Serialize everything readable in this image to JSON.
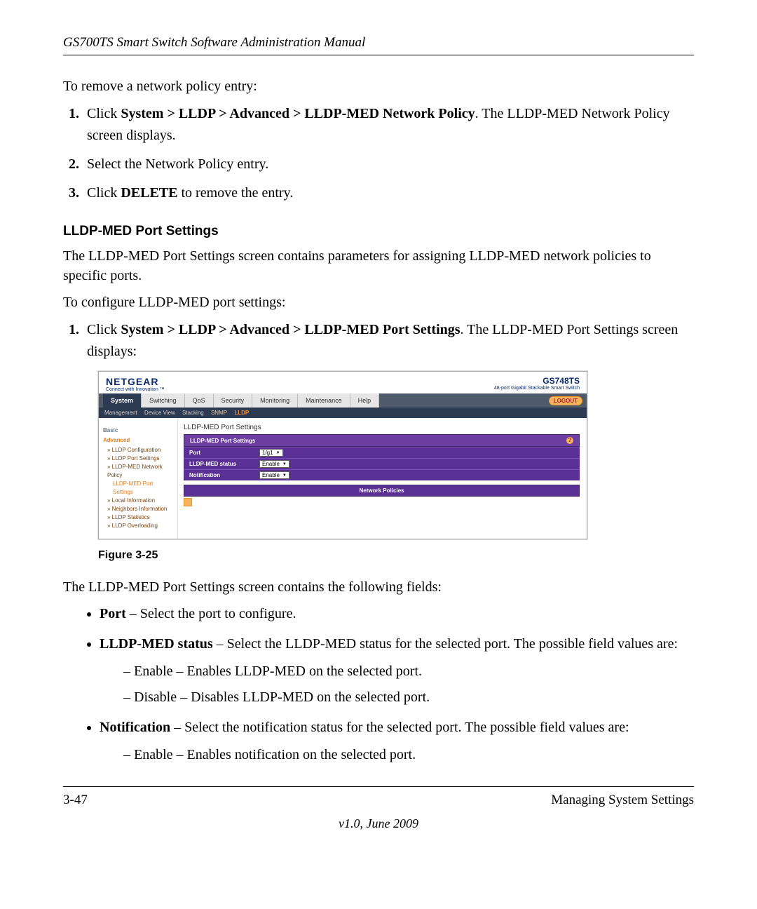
{
  "doc": {
    "header_title": "GS700TS Smart Switch Software Administration Manual",
    "intro_remove": "To remove a network policy entry:",
    "remove_steps": {
      "s1_pre": "Click ",
      "s1_bold": "System > LLDP > Advanced > LLDP-MED Network Policy",
      "s1_post": ". The LLDP-MED Network Policy screen displays.",
      "s2": "Select the Network Policy entry.",
      "s3_pre": "Click ",
      "s3_bold": "DELETE",
      "s3_post": " to remove the entry."
    },
    "section_title": "LLDP-MED Port Settings",
    "section_desc": "The LLDP-MED Port Settings screen contains parameters for assigning LLDP-MED network policies to specific ports.",
    "configure_intro": "To configure LLDP-MED port settings:",
    "configure_step1_pre": "Click ",
    "configure_step1_bold": "System > LLDP > Advanced > LLDP-MED Port Settings",
    "configure_step1_post": ". The LLDP-MED Port Settings screen displays:",
    "figure_caption": "Figure 3-25",
    "fields_intro": "The LLDP-MED Port Settings screen contains the following fields:",
    "bullets": {
      "port_b": "Port",
      "port_t": " – Select the port to configure.",
      "status_b": "LLDP-MED status",
      "status_t": " – Select the LLDP-MED status for the selected port. The possible field values are:",
      "status_en": "Enable – Enables LLDP-MED on the selected port.",
      "status_dis": "Disable – Disables LLDP-MED on the selected port.",
      "notif_b": "Notification",
      "notif_t": " – Select the notification status for the selected port. The possible field values are:",
      "notif_en": "Enable – Enables notification on the selected port."
    },
    "footer_left": "3-47",
    "footer_right": "Managing System Settings",
    "footer_version": "v1.0, June 2009"
  },
  "shot": {
    "brand": "NETGEAR",
    "brand_tag": "Connect with Innovation ™",
    "model": "GS748TS",
    "model_desc": "48-port Gigabit Stackable Smart Switch",
    "tabs1": [
      "System",
      "Switching",
      "QoS",
      "Security",
      "Monitoring",
      "Maintenance",
      "Help"
    ],
    "logout": "LOGOUT",
    "tabs2": [
      "Management",
      "Device View",
      "Stacking",
      "SNMP",
      "LLDP"
    ],
    "sidebar": {
      "basic": "Basic",
      "advanced": "Advanced",
      "items": [
        "LLDP Configuration",
        "LLDP Port Settings",
        "LLDP-MED Network Policy",
        "LLDP-MED Port Settings",
        "Local Information",
        "Neighbors Information",
        "LLDP Statistics",
        "LLDP Overloading"
      ]
    },
    "pane_title": "LLDP-MED Port Settings",
    "panel_head": "LLDP-MED Port Settings",
    "fields": {
      "port_label": "Port",
      "port_value": "1/g1",
      "status_label": "LLDP-MED status",
      "status_value": "Enable",
      "notif_label": "Notification",
      "notif_value": "Enable"
    },
    "network_policies": "Network Policies"
  }
}
